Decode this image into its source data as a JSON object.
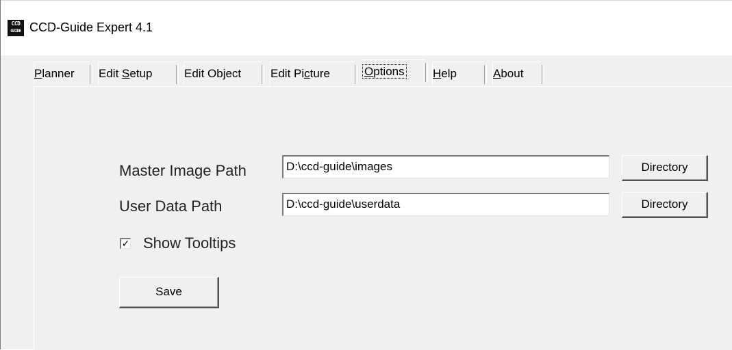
{
  "window": {
    "title": "CCD-Guide Expert 4.1",
    "app_icon_text_top": "CCD",
    "app_icon_text_bottom": "GUIDE"
  },
  "tabs": [
    {
      "pre": "",
      "accel": "P",
      "post": "lanner",
      "active": false
    },
    {
      "pre": "Edit ",
      "accel": "S",
      "post": "etup",
      "active": false
    },
    {
      "pre": "Edit Object",
      "accel": "",
      "post": "",
      "active": false
    },
    {
      "pre": "Edit Pi",
      "accel": "c",
      "post": "ture",
      "active": false
    },
    {
      "pre": "",
      "accel": "O",
      "post": "ptions",
      "active": true
    },
    {
      "pre": "",
      "accel": "H",
      "post": "elp",
      "active": false
    },
    {
      "pre": "",
      "accel": "A",
      "post": "bout",
      "active": false
    }
  ],
  "options": {
    "master_image_path_label": "Master Image Path",
    "master_image_path_value": "D:\\ccd-guide\\images",
    "user_data_path_label": "User Data Path",
    "user_data_path_value": "D:\\ccd-guide\\userdata",
    "directory_button_label": "Directory",
    "show_tooltips_label": "Show Tooltips",
    "show_tooltips_checked": true,
    "check_mark": "✓",
    "save_label": "Save"
  },
  "colors": {
    "window_bg": "#f0f0f0",
    "titlebar_bg": "#ffffff"
  }
}
